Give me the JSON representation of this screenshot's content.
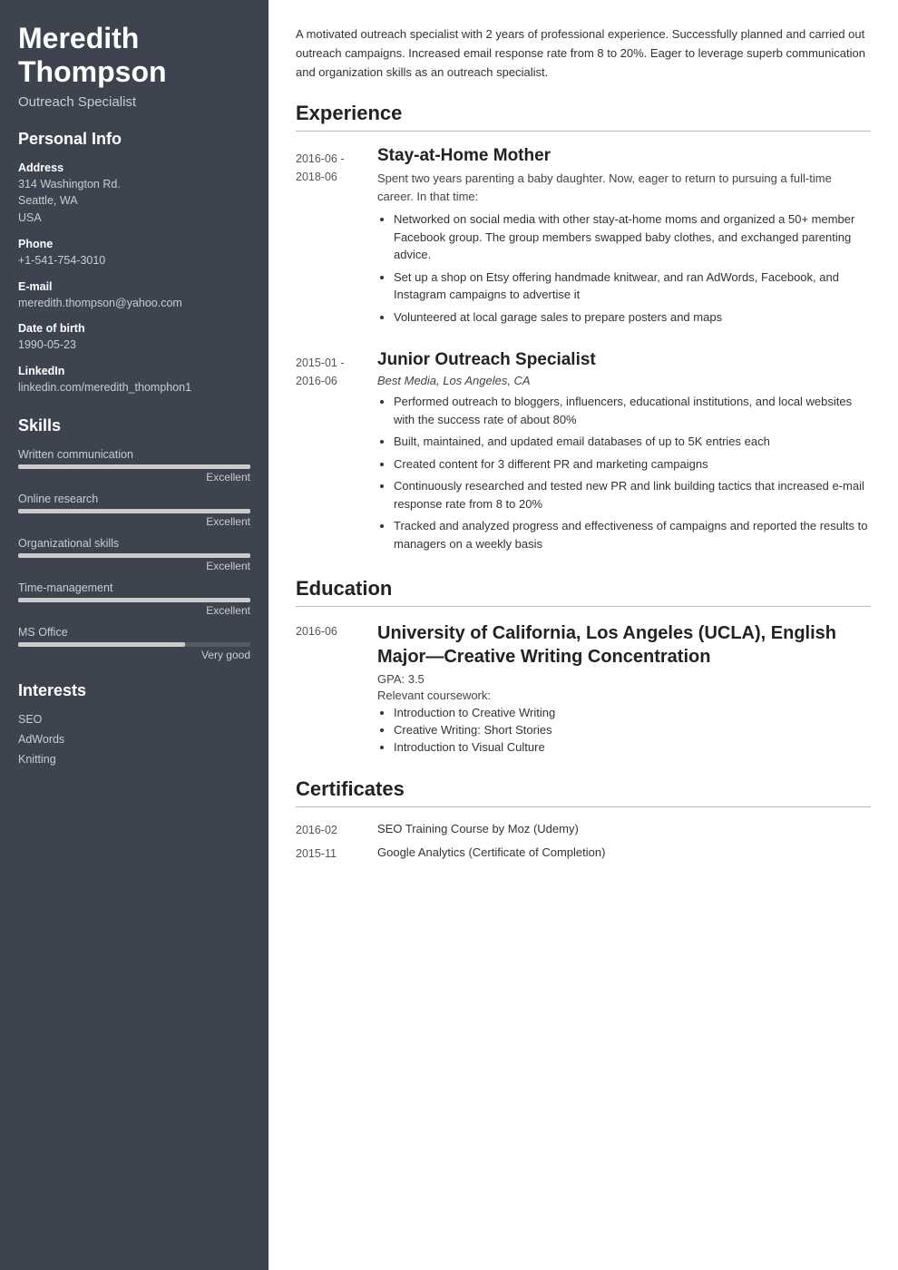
{
  "sidebar": {
    "name_line1": "Meredith",
    "name_line2": "Thompson",
    "title": "Outreach Specialist",
    "sections": {
      "personal_info": {
        "label": "Personal Info",
        "fields": [
          {
            "label": "Address",
            "values": [
              "314 Washington Rd.",
              "Seattle, WA",
              "USA"
            ]
          },
          {
            "label": "Phone",
            "values": [
              "+1-541-754-3010"
            ]
          },
          {
            "label": "E-mail",
            "values": [
              "meredith.thompson@yahoo.com"
            ]
          },
          {
            "label": "Date of birth",
            "values": [
              "1990-05-23"
            ]
          },
          {
            "label": "LinkedIn",
            "values": [
              "linkedin.com/meredith_thomphon1"
            ]
          }
        ]
      },
      "skills": {
        "label": "Skills",
        "items": [
          {
            "name": "Written communication",
            "percent": 100,
            "level": "Excellent"
          },
          {
            "name": "Online research",
            "percent": 100,
            "level": "Excellent"
          },
          {
            "name": "Organizational skills",
            "percent": 100,
            "level": "Excellent"
          },
          {
            "name": "Time-management",
            "percent": 100,
            "level": "Excellent"
          },
          {
            "name": "MS Office",
            "percent": 72,
            "level": "Very good"
          }
        ]
      },
      "interests": {
        "label": "Interests",
        "items": [
          "SEO",
          "AdWords",
          "Knitting"
        ]
      }
    }
  },
  "main": {
    "summary": "A motivated outreach specialist with 2 years of professional experience. Successfully planned and carried out outreach campaigns. Increased email response rate from 8 to 20%. Eager to leverage superb communication and organization skills as an outreach specialist.",
    "experience": {
      "label": "Experience",
      "entries": [
        {
          "date_start": "2016-06 -",
          "date_end": "2018-06",
          "title": "Stay-at-Home Mother",
          "company": "",
          "description": "Spent two years parenting a baby daughter. Now, eager to return to pursuing a full-time career. In that time:",
          "bullets": [
            "Networked on social media with other stay-at-home moms and organized a 50+ member Facebook group. The group members swapped baby clothes, and exchanged parenting advice.",
            "Set up a shop on Etsy offering handmade knitwear, and ran AdWords, Facebook, and Instagram campaigns to advertise it",
            "Volunteered at local garage sales to prepare posters and maps"
          ]
        },
        {
          "date_start": "2015-01 -",
          "date_end": "2016-06",
          "title": "Junior Outreach Specialist",
          "company": "Best Media, Los Angeles, CA",
          "description": "",
          "bullets": [
            "Performed outreach to bloggers, influencers, educational institutions, and local websites with the success rate of about 80%",
            "Built, maintained, and updated email databases of up to 5K entries each",
            "Created content for 3 different PR and marketing campaigns",
            "Continuously researched and tested new PR and link building tactics that increased e-mail response rate from 8 to 20%",
            "Tracked and analyzed progress and effectiveness of campaigns and reported the results to managers on a weekly basis"
          ]
        }
      ]
    },
    "education": {
      "label": "Education",
      "entries": [
        {
          "date": "2016-06",
          "school": "University of California, Los Angeles (UCLA), English Major—Creative Writing Concentration",
          "gpa": "GPA: 3.5",
          "coursework_label": "Relevant coursework:",
          "coursework": [
            "Introduction to Creative Writing",
            "Creative Writing: Short Stories",
            "Introduction to Visual Culture"
          ]
        }
      ]
    },
    "certificates": {
      "label": "Certificates",
      "entries": [
        {
          "date": "2016-02",
          "name": "SEO Training Course by Moz (Udemy)"
        },
        {
          "date": "2015-11",
          "name": "Google Analytics (Certificate of Completion)"
        }
      ]
    }
  }
}
